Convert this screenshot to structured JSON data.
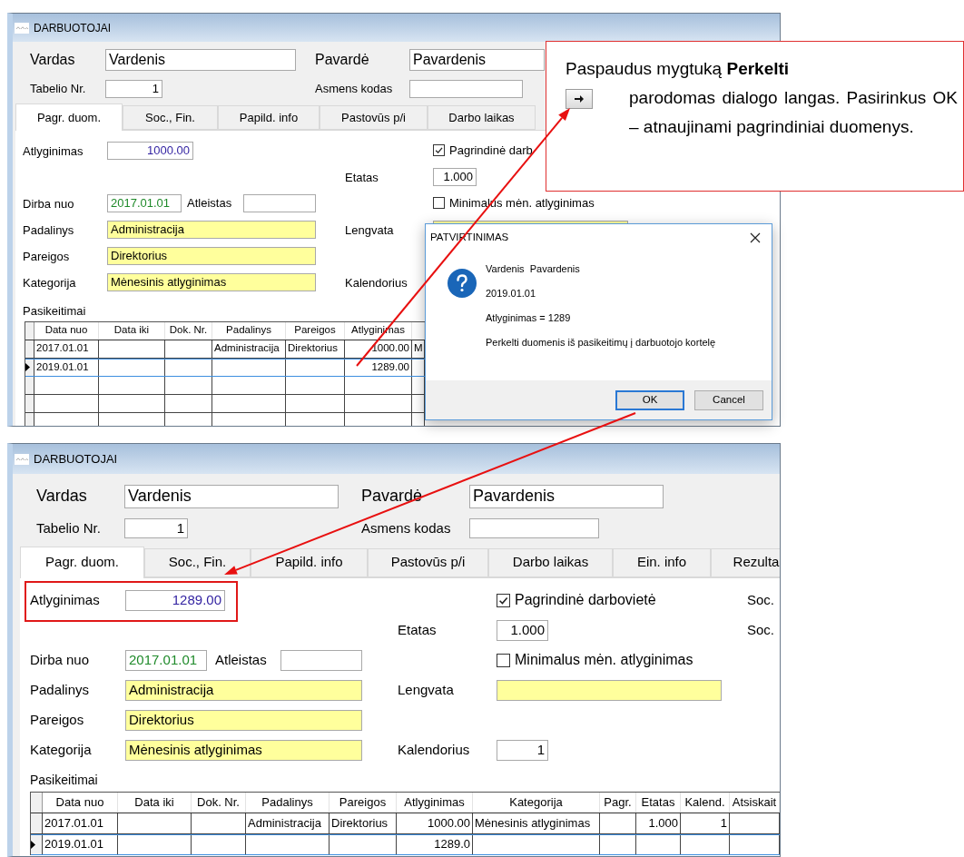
{
  "windows": [
    {
      "title": "DARBUOTOJAI",
      "header": [
        {
          "label": "Vardas",
          "field": {
            "kind": "text",
            "value": "Vardenis"
          }
        },
        {
          "label": "Pavardė",
          "field": {
            "kind": "text",
            "value": "Pavardenis"
          }
        },
        {
          "label": "Tabelio Nr.",
          "field": {
            "kind": "number",
            "value": "1"
          }
        },
        {
          "label": "Asmens kodas",
          "field": {
            "kind": "text"
          }
        }
      ],
      "tabs": [
        {
          "label": "Pagr. duom.",
          "selected": true
        },
        {
          "label": "Soc., Fin.",
          "selected": false
        },
        {
          "label": "Papild. info",
          "selected": false
        },
        {
          "label": "Pastovūs p/i",
          "selected": false
        },
        {
          "label": "Darbo laikas",
          "selected": false
        }
      ],
      "form_rows": [
        {
          "label": "Atlyginimas",
          "field": {
            "kind": "money",
            "value": "1000.00"
          },
          "right": {
            "kind": "checkbox",
            "label": "Pagrindinė darb",
            "checked": true
          }
        },
        {
          "mid_label": "Etatas",
          "right": {
            "kind": "number",
            "value": "1.000"
          }
        },
        {
          "label": "Dirba nuo",
          "field": {
            "kind": "date",
            "value": "2017.01.01"
          },
          "extra_label": "Atleistas",
          "extra_field": {
            "kind": "text"
          },
          "right": {
            "kind": "checkbox",
            "label": "Minimalus mėn. atlyginimas",
            "checked": false
          }
        },
        {
          "label": "Padalinys",
          "field": {
            "kind": "lookup",
            "value": "Administracija"
          },
          "mid_label": "Lengvata",
          "right": {
            "kind": "lookup"
          }
        },
        {
          "label": "Pareigos",
          "field": {
            "kind": "lookup",
            "value": "Direktorius"
          }
        },
        {
          "label": "Kategorija",
          "field": {
            "kind": "lookup",
            "value": "Mėnesinis atlyginimas"
          },
          "mid_label": "Kalendorius"
        }
      ],
      "changes_label": "Pasikeitimai",
      "table": {
        "columns": [
          "Data nuo",
          "Data iki",
          "Dok. Nr.",
          "Padalinys",
          "Pareigos",
          "Atlyginimas"
        ],
        "rows": [
          {
            "cells": [
              "2017.01.01",
              "",
              "",
              "Administracija",
              "Direktorius",
              "1000.00",
              "M"
            ],
            "selected": false
          },
          {
            "cells": [
              "2019.01.01",
              "",
              "",
              "",
              "",
              "1289.00",
              ""
            ],
            "selected": true
          }
        ]
      }
    },
    {
      "title": "DARBUOTOJAI",
      "header": [
        {
          "label": "Vardas",
          "field": {
            "kind": "text",
            "value": "Vardenis"
          }
        },
        {
          "label": "Pavardė",
          "field": {
            "kind": "text",
            "value": "Pavardenis"
          }
        },
        {
          "label": "Tabelio Nr.",
          "field": {
            "kind": "number",
            "value": "1"
          }
        },
        {
          "label": "Asmens kodas",
          "field": {
            "kind": "text"
          }
        }
      ],
      "tabs": [
        {
          "label": "Pagr. duom.",
          "selected": true
        },
        {
          "label": "Soc., Fin.",
          "selected": false
        },
        {
          "label": "Papild. info",
          "selected": false
        },
        {
          "label": "Pastovūs p/i",
          "selected": false
        },
        {
          "label": "Darbo laikas",
          "selected": false
        },
        {
          "label": "Ein. info",
          "selected": false
        },
        {
          "label": "Rezulta",
          "selected": false
        }
      ],
      "form_rows": [
        {
          "label": "Atlyginimas",
          "field": {
            "kind": "money",
            "value": "1289.00"
          },
          "right": {
            "kind": "checkbox",
            "label": "Pagrindinė darbovietė",
            "checked": true
          },
          "side_label": "Soc."
        },
        {
          "mid_label": "Etatas",
          "right": {
            "kind": "number",
            "value": "1.000"
          },
          "side_label": "Soc."
        },
        {
          "label": "Dirba nuo",
          "field": {
            "kind": "date",
            "value": "2017.01.01"
          },
          "extra_label": "Atleistas",
          "extra_field": {
            "kind": "text"
          },
          "right": {
            "kind": "checkbox",
            "label": "Minimalus mėn. atlyginimas",
            "checked": false
          }
        },
        {
          "label": "Padalinys",
          "field": {
            "kind": "lookup",
            "value": "Administracija"
          },
          "mid_label": "Lengvata",
          "right": {
            "kind": "lookup"
          }
        },
        {
          "label": "Pareigos",
          "field": {
            "kind": "lookup",
            "value": "Direktorius"
          }
        },
        {
          "label": "Kategorija",
          "field": {
            "kind": "lookup",
            "value": "Mėnesinis atlyginimas"
          },
          "mid_label": "Kalendorius",
          "right": {
            "kind": "number",
            "value": "1"
          }
        }
      ],
      "changes_label": "Pasikeitimai",
      "table": {
        "columns": [
          "Data nuo",
          "Data iki",
          "Dok. Nr.",
          "Padalinys",
          "Pareigos",
          "Atlyginimas",
          "Kategorija",
          "Pagr.",
          "Etatas",
          "Kalend.",
          "Atsiskait"
        ],
        "rows": [
          {
            "cells": [
              "2017.01.01",
              "",
              "",
              "Administracija",
              "Direktorius",
              "1000.00",
              "Mėnesinis atlyginimas",
              "",
              "1.000",
              "1",
              ""
            ],
            "selected": false
          },
          {
            "cells": [
              "2019.01.01",
              "",
              "",
              "",
              "",
              "1289.0",
              "",
              "",
              "",
              "",
              ""
            ],
            "selected": true
          }
        ]
      }
    }
  ],
  "dialog": {
    "title": "PATVIRTINIMAS",
    "lines": [
      "Vardenis  Pavardenis",
      "2019.01.01",
      "Atlyginimas = 1289",
      "Perkelti duomenis iš pasikeitimų į darbuotojo kortelę"
    ],
    "buttons": [
      {
        "label": "OK",
        "focused": true
      },
      {
        "label": "Cancel",
        "focused": false
      }
    ]
  },
  "callout": {
    "lead": "Paspaudus mygtuką **Perkelti**",
    "text": "parodomas dialogo langas. Pasirinkus OK – atnaujinami pagrindiniai duomenys."
  }
}
